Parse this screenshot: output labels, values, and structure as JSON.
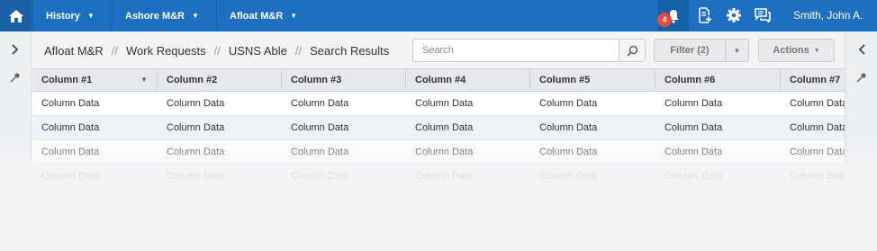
{
  "topbar": {
    "nav": [
      {
        "label": "History"
      },
      {
        "label": "Ashore M&R"
      },
      {
        "label": "Afloat M&R"
      }
    ],
    "notification_count": "4",
    "user_name": "Smith, John A."
  },
  "breadcrumb": {
    "items": [
      "Afloat M&R",
      "Work Requests",
      "USNS Able",
      "Search Results"
    ],
    "separator": "//"
  },
  "search": {
    "placeholder": "Search",
    "value": ""
  },
  "toolbar": {
    "filter_label": "Filter (2)",
    "actions_label": "Actions"
  },
  "table": {
    "columns": [
      "Column #1",
      "Column #2",
      "Column #3",
      "Column #4",
      "Column #5",
      "Column #6",
      "Column #7"
    ],
    "rows": [
      [
        "Column Data",
        "Column Data",
        "Column Data",
        "Column Data",
        "Column Data",
        "Column Data",
        "Column Data"
      ],
      [
        "Column Data",
        "Column Data",
        "Column Data",
        "Column Data",
        "Column Data",
        "Column Data",
        "Column Data"
      ],
      [
        "Column Data",
        "Column Data",
        "Column Data",
        "Column Data",
        "Column Data",
        "Column Data",
        "Column Data"
      ],
      [
        "Column Data",
        "Column Data",
        "Column Data",
        "Column Data",
        "Column Data",
        "Column Data",
        "Column Data"
      ]
    ]
  },
  "colors": {
    "topbar": "#1c6fc1",
    "badge": "#e8493d",
    "row_alt": "#eef3fa"
  },
  "icons": [
    "home-icon",
    "bell-icon",
    "document-add-icon",
    "gear-icon",
    "chat-icon",
    "chevron-right-icon",
    "chevron-left-icon",
    "pin-icon",
    "search-icon"
  ]
}
